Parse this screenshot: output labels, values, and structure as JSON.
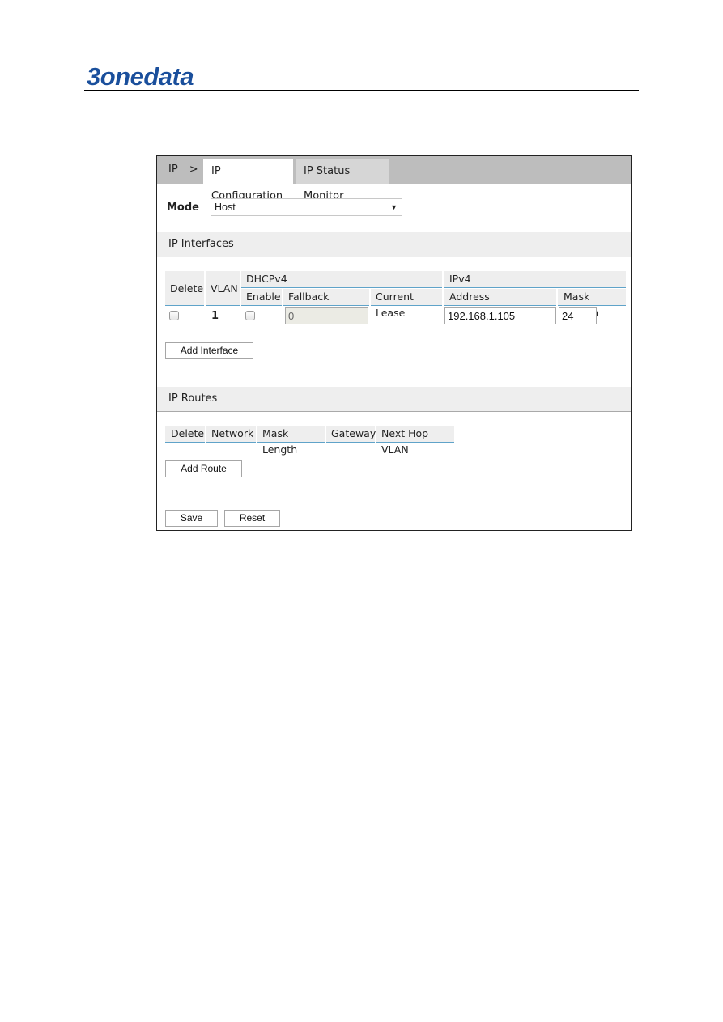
{
  "brand": {
    "logo_text": "3onedata"
  },
  "nav": {
    "breadcrumb_root": "IP",
    "breadcrumb_separator": ">",
    "tabs": [
      {
        "label": "IP Configuration",
        "active": true
      },
      {
        "label": "IP Status Monitor",
        "active": false
      }
    ]
  },
  "mode": {
    "label": "Mode",
    "value": "Host",
    "arrow_icon": "▼"
  },
  "ip_interfaces": {
    "title": "IP Interfaces",
    "headers": {
      "delete": "Delete",
      "vlan": "VLAN",
      "dhcpv4": "DHCPv4",
      "enable": "Enable",
      "fallback": "Fallback",
      "current_lease": "Current Lease",
      "ipv4": "IPv4",
      "address": "Address",
      "mask_length": "Mask Length"
    },
    "rows": [
      {
        "delete_checked": false,
        "vlan": "1",
        "dhcp_enable_checked": false,
        "fallback": "0",
        "current_lease": "",
        "address": "192.168.1.105",
        "mask_length": "24"
      }
    ],
    "add_button": "Add Interface"
  },
  "ip_routes": {
    "title": "IP Routes",
    "headers": [
      "Delete",
      "Network",
      "Mask Length",
      "Gateway",
      "Next Hop VLAN"
    ],
    "add_button": "Add Route"
  },
  "actions": {
    "save": "Save",
    "reset": "Reset"
  },
  "colors": {
    "brand": "#1a4f9c",
    "header_underline": "#5fa3c9",
    "tabbar": "#bdbdbd"
  }
}
